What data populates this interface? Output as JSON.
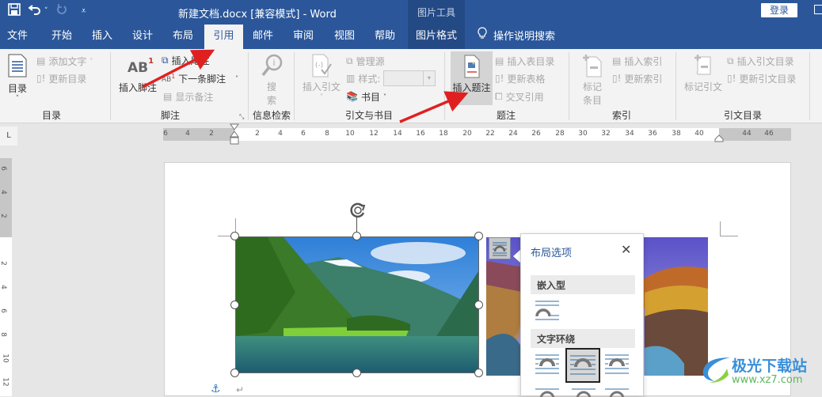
{
  "titlebar": {
    "doc_title": "新建文档.docx [兼容模式]  -  Word",
    "context_group": "图片工具",
    "login_label": "登录",
    "qat_icons": [
      "save-icon",
      "undo-icon",
      "undo-dropdown-icon",
      "redo-icon",
      "customize-qat-icon"
    ]
  },
  "tabs": [
    {
      "label": "文件"
    },
    {
      "label": "开始"
    },
    {
      "label": "插入"
    },
    {
      "label": "设计"
    },
    {
      "label": "布局"
    },
    {
      "label": "引用",
      "active": true
    },
    {
      "label": "邮件"
    },
    {
      "label": "审阅"
    },
    {
      "label": "视图"
    },
    {
      "label": "帮助"
    },
    {
      "label": "图片格式",
      "contextual": true
    }
  ],
  "tell_me": "操作说明搜索",
  "ribbon": {
    "groups": {
      "toc": {
        "label": "目录",
        "toc_button": "目录",
        "add_text": "添加文字",
        "update_toc": "更新目录"
      },
      "footnotes": {
        "label": "脚注",
        "insert_footnote": "插入脚注",
        "insert_endnote": "插入尾注",
        "next_footnote": "下一条脚注",
        "show_notes": "显示备注",
        "ab_glyph": "AB",
        "sup": "1"
      },
      "research": {
        "label": "信息检索",
        "search_line1": "搜",
        "search_line2": "索"
      },
      "citations": {
        "label": "引文与书目",
        "insert_citation": "插入引文",
        "manage_sources": "管理源",
        "style_label": "样式:",
        "style_value": "",
        "bibliography": "书目"
      },
      "captions": {
        "label": "题注",
        "insert_caption": "插入题注",
        "insert_tof": "插入表目录",
        "update_table": "更新表格",
        "cross_ref": "交叉引用"
      },
      "index": {
        "label": "索引",
        "mark_entry_line1": "标记",
        "mark_entry_line2": "条目",
        "insert_index": "插入索引",
        "update_index": "更新索引"
      },
      "toa": {
        "label": "引文目录",
        "mark_citation": "标记引文",
        "insert_toa": "插入引文目录",
        "update_toa": "更新引文目录"
      }
    }
  },
  "ruler": {
    "horizontal_ticks": [
      "6",
      "4",
      "2",
      "2",
      "4",
      "6",
      "8",
      "10",
      "12",
      "14",
      "16",
      "18",
      "20",
      "22",
      "24",
      "26",
      "28",
      "30",
      "32",
      "34",
      "36",
      "38",
      "40",
      "44",
      "46"
    ],
    "vertical_ticks": [
      "6",
      "4",
      "2",
      "2",
      "4",
      "6",
      "8",
      "10",
      "12"
    ],
    "tab_selector": "L"
  },
  "layout_popup": {
    "title": "布局选项",
    "close": "✕",
    "section_inline": "嵌入型",
    "section_wrap": "文字环绕",
    "selected_wrap_index": 1
  },
  "watermark": {
    "brand": "极光下载站",
    "url": "www.xz7.com"
  },
  "colors": {
    "brand_blue": "#2b579a",
    "arrow_red": "#e02020"
  }
}
